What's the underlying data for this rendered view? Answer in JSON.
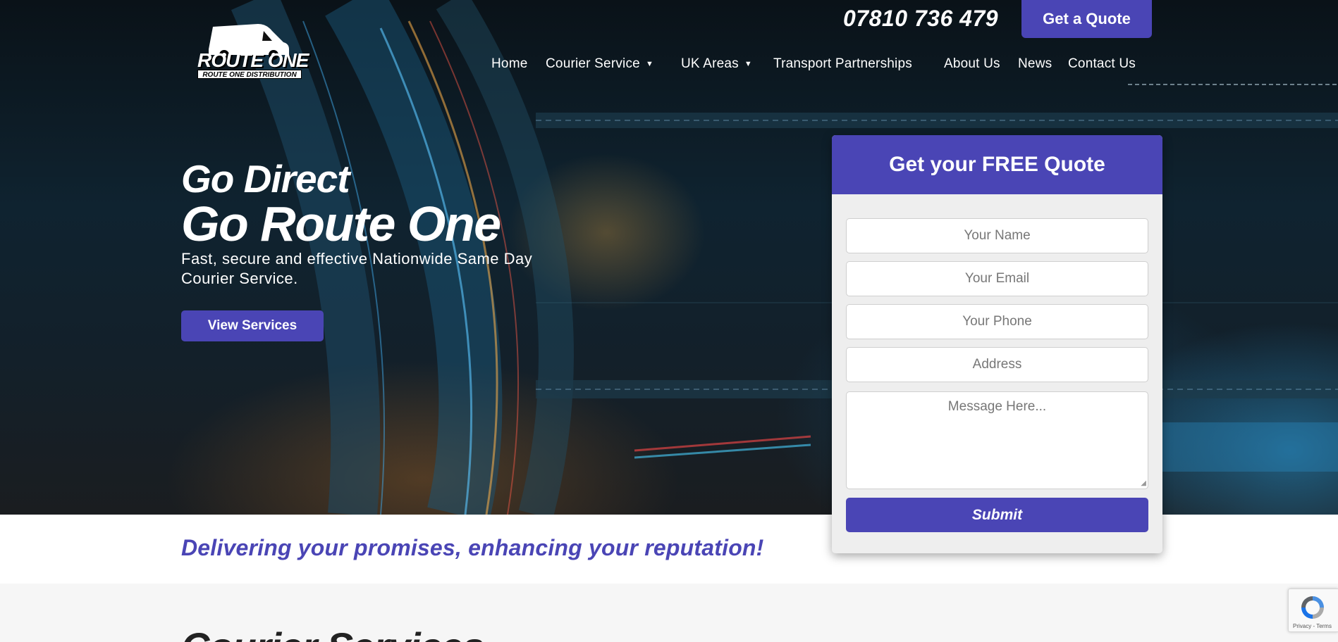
{
  "header": {
    "logo_text": "ROUTE ONE",
    "logo_subtext": "ROUTE ONE DISTRIBUTION",
    "phone": "07810 736 479",
    "quote_button": "Get a Quote"
  },
  "nav": {
    "items": [
      {
        "label": "Home",
        "has_dropdown": false
      },
      {
        "label": "Courier Service",
        "has_dropdown": true
      },
      {
        "label": "UK Areas",
        "has_dropdown": true
      },
      {
        "label": "Transport Partnerships",
        "has_dropdown": false
      },
      {
        "label": "About Us",
        "has_dropdown": false
      },
      {
        "label": "News",
        "has_dropdown": false
      },
      {
        "label": "Contact Us",
        "has_dropdown": false
      }
    ],
    "caret": "▼"
  },
  "hero": {
    "line1": "Go Direct",
    "line2": "Go Route One",
    "subtitle": "Fast, secure and effective Nationwide Same Day Courier Service.",
    "cta": "View Services"
  },
  "form": {
    "title": "Get your FREE Quote",
    "fields": {
      "name": "Your Name",
      "email": "Your Email",
      "phone": "Your Phone",
      "address": "Address",
      "message": "Message Here..."
    },
    "submit": "Submit"
  },
  "tagline": "Delivering your promises, enhancing your reputation!",
  "section_title": "Courier Services",
  "recaptcha": {
    "links": "Privacy - Terms"
  },
  "colors": {
    "brand": "#4a45b5",
    "form_bg": "#eeeeee",
    "section_bg": "#f6f6f6"
  }
}
